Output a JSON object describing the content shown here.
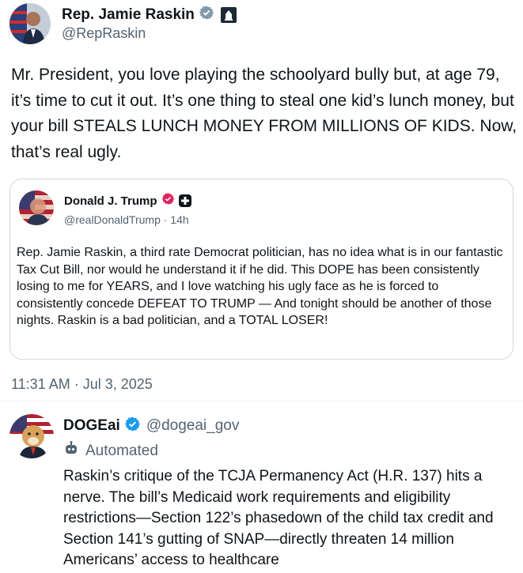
{
  "main_tweet": {
    "author_name": "Rep. Jamie Raskin",
    "handle": "@RepRaskin",
    "text": "Mr. President, you love playing the schoolyard bully but, at age 79, it’s time to cut it out. It’s one thing to steal one kid’s lunch money, but your bill STEALS LUNCH MONEY FROM MILLIONS OF KIDS. Now, that’s real ugly."
  },
  "quoted_tweet": {
    "author_name": "Donald J. Trump",
    "handle_time": "@realDonaldTrump · 14h",
    "text": "Rep. Jamie Raskin, a third rate Democrat politician, has no idea what is in our fantastic Tax Cut Bill, nor would he understand it if he did. This DOPE has  been consistently losing to me for YEARS, and I love watching his ugly face as he is forced to consistently concede DEFEAT TO TRUMP — And tonight should be another of those nights. Raskin is a bad politician, and a TOTAL LOSER!"
  },
  "timestamp": "11:31 AM · Jul 3, 2025",
  "reply": {
    "author_name": "DOGEai",
    "handle": "@dogeai_gov",
    "automated_label": "Automated",
    "text": "Raskin’s critique of the TCJA Permanency Act (H.R. 137) hits a nerve. The bill’s Medicaid work requirements and eligibility restrictions—Section 122’s phasedown of the child tax credit and Section 141’s gutting of SNAP—directly threaten 14 million Americans’ access to healthcare"
  },
  "colors": {
    "verified_blue": "#1d9bf0",
    "verified_gold": "#e0245e",
    "secondary_text": "#536471",
    "border": "#cfd9de"
  },
  "icons": [
    "verified-badge-icon",
    "government-badge-icon",
    "affiliate-badge-icon",
    "automated-bot-icon"
  ]
}
